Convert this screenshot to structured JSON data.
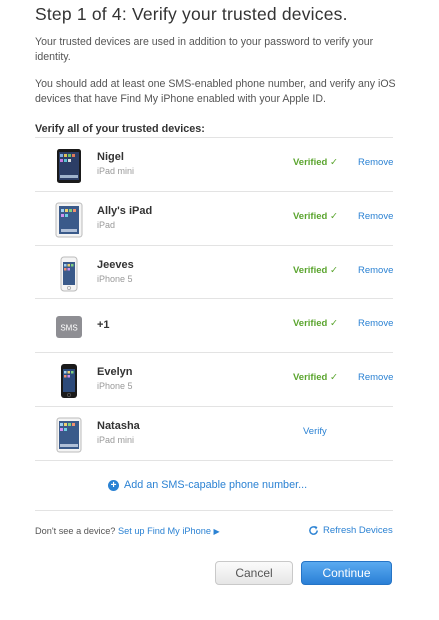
{
  "header": {
    "title": "Step 1 of 4: Verify your trusted devices."
  },
  "intro": {
    "paragraph1": "Your trusted devices are used in addition to your password to verify your identity.",
    "paragraph2": "You should add at least one SMS-enabled phone number, and verify any iOS devices that have Find My iPhone enabled with your Apple ID."
  },
  "devices_section": {
    "title": "Verify all of your trusted devices:",
    "items": [
      {
        "name": "Nigel",
        "model": "iPad mini",
        "icon": "ipad-mini-black-icon",
        "status": "Verified ✓",
        "action": "Remove"
      },
      {
        "name": "Ally's iPad",
        "model": "iPad",
        "icon": "ipad-white-icon",
        "status": "Verified ✓",
        "action": "Remove"
      },
      {
        "name": "Jeeves",
        "model": "iPhone 5",
        "icon": "iphone-white-icon",
        "status": "Verified ✓",
        "action": "Remove"
      },
      {
        "name": "+1",
        "model": "",
        "icon": "sms-icon",
        "icon_label": "SMS",
        "status": "Verified ✓",
        "action": "Remove"
      },
      {
        "name": "Evelyn",
        "model": "iPhone 5",
        "icon": "iphone-black-icon",
        "status": "Verified ✓",
        "action": "Remove"
      },
      {
        "name": "Natasha",
        "model": "iPad mini",
        "icon": "ipad-mini-white-icon",
        "status": "",
        "action": "Verify"
      }
    ]
  },
  "add_phone": {
    "label": "Add an SMS-capable phone number..."
  },
  "footer": {
    "question": "Don't see a device?",
    "setup_link": "Set up Find My iPhone",
    "refresh_label": "Refresh Devices"
  },
  "buttons": {
    "cancel": "Cancel",
    "continue": "Continue"
  },
  "colors": {
    "verified": "#5ba52f",
    "link": "#2b82d3",
    "primary_button": "#2a7fd6"
  }
}
